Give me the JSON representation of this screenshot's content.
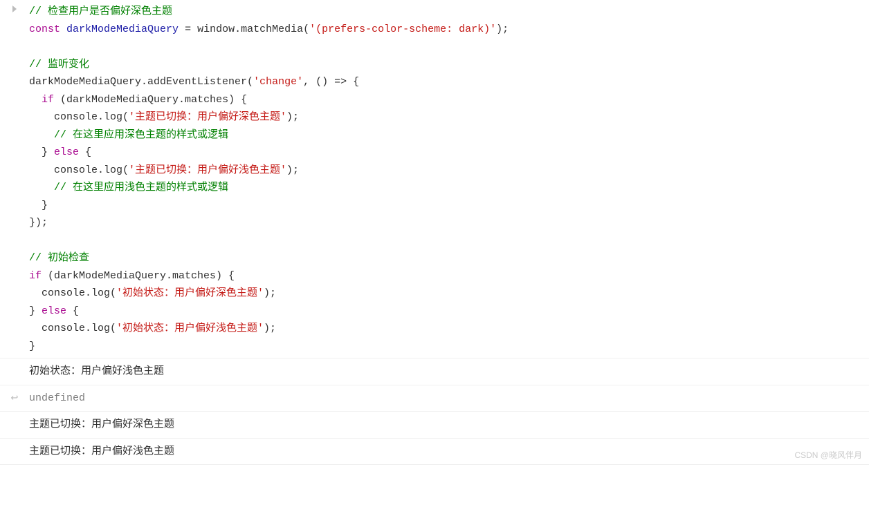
{
  "code": {
    "tokens": [
      [
        {
          "t": "comment",
          "v": "// 检查用户是否偏好深色主题"
        }
      ],
      [
        {
          "t": "keyword",
          "v": "const"
        },
        {
          "t": "default",
          "v": " "
        },
        {
          "t": "var",
          "v": "darkModeMediaQuery"
        },
        {
          "t": "default",
          "v": " = window.matchMedia("
        },
        {
          "t": "string",
          "v": "'(prefers-color-scheme: dark)'"
        },
        {
          "t": "default",
          "v": ");"
        }
      ],
      [
        {
          "t": "default",
          "v": ""
        }
      ],
      [
        {
          "t": "comment",
          "v": "// 监听变化"
        }
      ],
      [
        {
          "t": "default",
          "v": "darkModeMediaQuery.addEventListener("
        },
        {
          "t": "string",
          "v": "'change'"
        },
        {
          "t": "default",
          "v": ", () => {"
        }
      ],
      [
        {
          "t": "default",
          "v": "  "
        },
        {
          "t": "keyword",
          "v": "if"
        },
        {
          "t": "default",
          "v": " (darkModeMediaQuery.matches) {"
        }
      ],
      [
        {
          "t": "default",
          "v": "    console.log("
        },
        {
          "t": "string",
          "v": "'主题已切换：用户偏好深色主题'"
        },
        {
          "t": "default",
          "v": ");"
        }
      ],
      [
        {
          "t": "default",
          "v": "    "
        },
        {
          "t": "comment",
          "v": "// 在这里应用深色主题的样式或逻辑"
        }
      ],
      [
        {
          "t": "default",
          "v": "  } "
        },
        {
          "t": "keyword",
          "v": "else"
        },
        {
          "t": "default",
          "v": " {"
        }
      ],
      [
        {
          "t": "default",
          "v": "    console.log("
        },
        {
          "t": "string",
          "v": "'主题已切换：用户偏好浅色主题'"
        },
        {
          "t": "default",
          "v": ");"
        }
      ],
      [
        {
          "t": "default",
          "v": "    "
        },
        {
          "t": "comment",
          "v": "// 在这里应用浅色主题的样式或逻辑"
        }
      ],
      [
        {
          "t": "default",
          "v": "  }"
        }
      ],
      [
        {
          "t": "default",
          "v": "});"
        }
      ],
      [
        {
          "t": "default",
          "v": ""
        }
      ],
      [
        {
          "t": "comment",
          "v": "// 初始检查"
        }
      ],
      [
        {
          "t": "keyword",
          "v": "if"
        },
        {
          "t": "default",
          "v": " (darkModeMediaQuery.matches) {"
        }
      ],
      [
        {
          "t": "default",
          "v": "  console.log("
        },
        {
          "t": "string",
          "v": "'初始状态：用户偏好深色主题'"
        },
        {
          "t": "default",
          "v": ");"
        }
      ],
      [
        {
          "t": "default",
          "v": "} "
        },
        {
          "t": "keyword",
          "v": "else"
        },
        {
          "t": "default",
          "v": " {"
        }
      ],
      [
        {
          "t": "default",
          "v": "  console.log("
        },
        {
          "t": "string",
          "v": "'初始状态：用户偏好浅色主题'"
        },
        {
          "t": "default",
          "v": ");"
        }
      ],
      [
        {
          "t": "default",
          "v": "}"
        }
      ]
    ]
  },
  "output": {
    "log1": "初始状态：用户偏好浅色主题",
    "return_value": "undefined",
    "log2": "主题已切换：用户偏好深色主题",
    "log3": "主题已切换：用户偏好浅色主题"
  },
  "watermark": "CSDN @晓风伴月"
}
